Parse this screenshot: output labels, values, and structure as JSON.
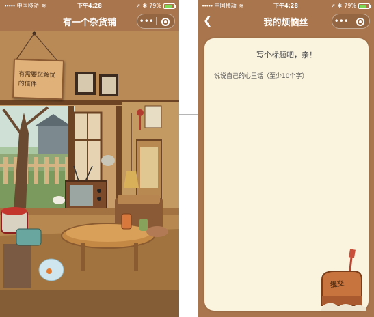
{
  "left_phone": {
    "status": {
      "signal": "•••••",
      "carrier": "中国移动",
      "time": "下午4:28",
      "battery_percent": "79%",
      "battery_level": 0.79
    },
    "nav_title": "有一个杂货铺",
    "capsule": {
      "menu": "•••"
    },
    "sign_text": "有需要您解忧的信件"
  },
  "right_phone": {
    "status": {
      "signal": "•••••",
      "carrier": "中国移动",
      "time": "下午4:28",
      "battery_percent": "79%",
      "battery_level": 0.79
    },
    "nav_title": "我的烦恼丝",
    "back_icon": "chevron-left-icon",
    "capsule": {
      "menu": "•••"
    },
    "title_placeholder": "写个标题吧，亲！",
    "body_placeholder": "说说自己的心里话（至少10个字）",
    "submit_label": "提交"
  },
  "colors": {
    "brown": "#a9754c",
    "paper": "#faf3de",
    "battery": "#7ed957"
  }
}
